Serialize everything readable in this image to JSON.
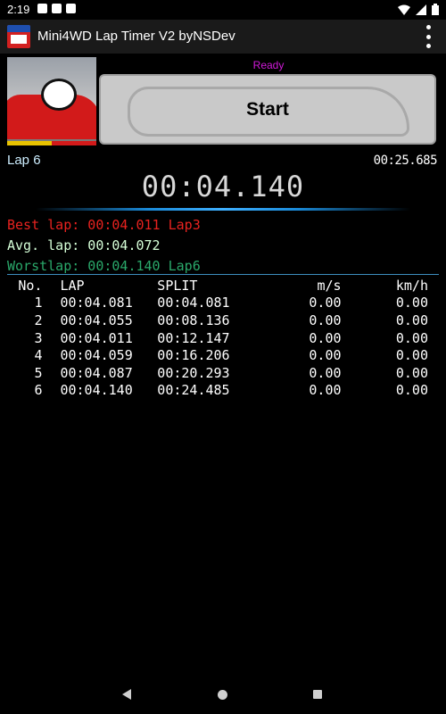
{
  "status": {
    "time": "2:19",
    "icons": [
      "p-icon",
      "notification-icon",
      "sd-card-icon"
    ],
    "right_icons": [
      "wifi-icon",
      "signal-icon",
      "battery-icon"
    ]
  },
  "app": {
    "title": "Mini4WD Lap Timer V2 byNSDev",
    "logo_icon": "lap-timer-logo",
    "menu_icon": "overflow-menu-icon"
  },
  "timer": {
    "state": "Ready",
    "start_label": "Start",
    "current_lap": "Lap 6",
    "total_time": "00:25.685",
    "current_time": "00:04.140"
  },
  "stats": {
    "best": "Best lap: 00:04.011 Lap3",
    "avg": "Avg. lap: 00:04.072",
    "worst": "Worstlap: 00:04.140 Lap6"
  },
  "table": {
    "headers": [
      "No.",
      "LAP",
      "SPLIT",
      "m/s",
      "km/h"
    ],
    "rows": [
      [
        "1",
        "00:04.081",
        "00:04.081",
        "0.00",
        "0.00"
      ],
      [
        "2",
        "00:04.055",
        "00:08.136",
        "0.00",
        "0.00"
      ],
      [
        "3",
        "00:04.011",
        "00:12.147",
        "0.00",
        "0.00"
      ],
      [
        "4",
        "00:04.059",
        "00:16.206",
        "0.00",
        "0.00"
      ],
      [
        "5",
        "00:04.087",
        "00:20.293",
        "0.00",
        "0.00"
      ],
      [
        "6",
        "00:04.140",
        "00:24.485",
        "0.00",
        "0.00"
      ]
    ]
  },
  "colors": {
    "best": "#e8221f",
    "avg": "#d6ffd8",
    "worst": "#2aa86a",
    "ready": "#d01ad8",
    "lap_label": "#cdeeff"
  },
  "nav": {
    "back_icon": "back-icon",
    "home_icon": "home-icon",
    "recents_icon": "recents-icon"
  }
}
